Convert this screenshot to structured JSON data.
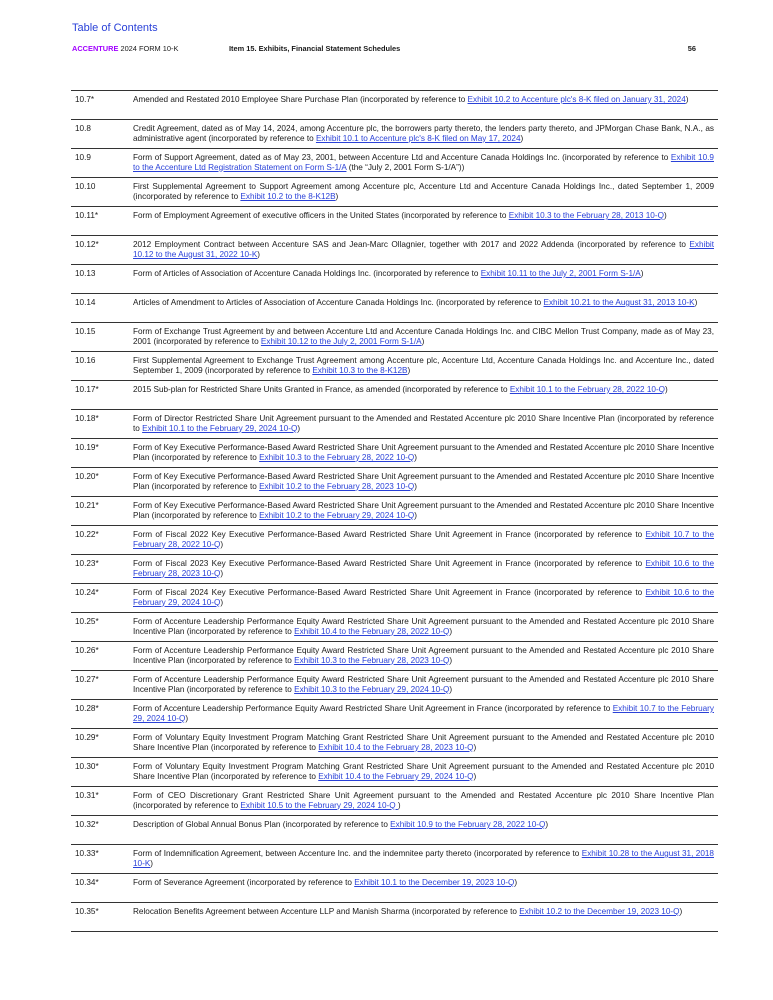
{
  "toc_link": "Table of Contents",
  "header": {
    "brand": "ACCENTURE",
    "form": " 2024 FORM 10-K",
    "section": "Item 15. Exhibits, Financial Statement Schedules",
    "page_number": "56"
  },
  "exhibits": [
    {
      "num": "10.7*",
      "text": "Amended and Restated 2010 Employee Share Purchase Plan (incorporated by reference to ",
      "link": "Exhibit 10.2 to Accenture plc's 8-K filed on January 31, 2024",
      "after": ")"
    },
    {
      "num": "10.8",
      "text": "Credit Agreement, dated as of May 14, 2024, among Accenture plc, the borrowers party thereto, the lenders party thereto, and JPMorgan Chase Bank, N.A., as administrative agent (incorporated by reference to ",
      "link": "Exhibit 10.1 to Accenture plc's 8-K filed on May 17, 2024",
      "after": ")"
    },
    {
      "num": "10.9",
      "text": "Form of Support Agreement, dated as of May 23, 2001, between Accenture Ltd and Accenture Canada Holdings Inc. (incorporated by reference to ",
      "link": "Exhibit 10.9 to the Accenture Ltd Registration Statement on Form S-1/A",
      "after": " (the “July 2, 2001 Form S-1/A”))"
    },
    {
      "num": "10.10",
      "text": "First Supplemental Agreement to Support Agreement among Accenture plc, Accenture Ltd and Accenture Canada Holdings Inc., dated September 1, 2009 (incorporated by reference to ",
      "link": "Exhibit 10.2 to the 8-K12B",
      "after": ")"
    },
    {
      "num": "10.11*",
      "text": "Form of Employment Agreement of executive officers in the United States (incorporated by reference to ",
      "link": "Exhibit 10.3 to the February 28, 2013 10-Q",
      "after": ")"
    },
    {
      "num": "10.12*",
      "text": "2012 Employment Contract between Accenture SAS and Jean-Marc Ollagnier, together with 2017 and 2022 Addenda (incorporated by reference to ",
      "link": "Exhibit 10.12 to the August 31, 2022 10-K",
      "after": ")"
    },
    {
      "num": "10.13",
      "text": "Form of Articles of Association of Accenture Canada Holdings Inc. (incorporated by reference to ",
      "link": "Exhibit 10.11 to the July 2, 2001 Form S-1/A",
      "after": ")"
    },
    {
      "num": "10.14",
      "text": "Articles of Amendment to Articles of Association of Accenture Canada Holdings Inc. (incorporated by reference to ",
      "link": "Exhibit 10.21 to the August 31, 2013 10-K",
      "after": ")"
    },
    {
      "num": "10.15",
      "text": "Form of Exchange Trust Agreement by and between Accenture Ltd and Accenture Canada Holdings Inc. and CIBC Mellon Trust Company, made as of May 23, 2001 (incorporated by reference to ",
      "link": "Exhibit 10.12 to the July 2, 2001 Form S-1/A",
      "after": ")"
    },
    {
      "num": "10.16",
      "text": "First Supplemental Agreement to Exchange Trust Agreement among Accenture plc, Accenture Ltd, Accenture Canada Holdings Inc. and Accenture Inc., dated September 1, 2009 (incorporated by reference to ",
      "link": "Exhibit 10.3 to the 8-K12B",
      "after": ")"
    },
    {
      "num": "10.17*",
      "text": "2015 Sub-plan for Restricted Share Units Granted in France, as amended (incorporated by reference to ",
      "link": "Exhibit 10.1 to the February 28, 2022 10-Q",
      "after": ")"
    },
    {
      "num": "10.18*",
      "text": "Form of Director Restricted Share Unit Agreement pursuant to the Amended and Restated Accenture plc 2010 Share Incentive Plan (incorporated by reference to ",
      "link": "Exhibit 10.1 to the February 29, 2024 10-Q",
      "after": ")"
    },
    {
      "num": "10.19*",
      "text": "Form of Key Executive Performance-Based Award Restricted Share Unit Agreement pursuant to the Amended and Restated Accenture plc 2010 Share Incentive Plan (incorporated by reference to ",
      "link": "Exhibit 10.3 to the February 28, 2022 10-Q",
      "after": ")"
    },
    {
      "num": "10.20*",
      "text": "Form of Key Executive Performance-Based Award Restricted Share Unit Agreement pursuant to the Amended and Restated Accenture plc 2010 Share Incentive Plan (incorporated by reference to ",
      "link": "Exhibit 10.2 to the February 28, 2023 10-Q",
      "after": ")"
    },
    {
      "num": "10.21*",
      "text": "Form of Key Executive Performance-Based Award Restricted Share Unit Agreement pursuant to the Amended and Restated Accenture plc 2010 Share Incentive Plan (incorporated by reference to ",
      "link": "Exhibit 10.2 to the February 29, 2024 10-Q",
      "after": ")"
    },
    {
      "num": "10.22*",
      "text": "Form of Fiscal 2022 Key Executive Performance-Based Award Restricted Share Unit Agreement in France (incorporated by reference to ",
      "link": "Exhibit 10.7 to the February 28, 2022 10-Q",
      "after": ")"
    },
    {
      "num": "10.23*",
      "text": "Form of Fiscal 2023 Key Executive Performance-Based Award Restricted Share Unit Agreement in France (incorporated by reference to ",
      "link": "Exhibit 10.6 to the February 28, 2023 10-Q",
      "after": ")"
    },
    {
      "num": "10.24*",
      "text": "Form of Fiscal 2024 Key Executive Performance-Based Award Restricted Share Unit Agreement in France (incorporated by reference to ",
      "link": "Exhibit 10.6 to the February 29, 2024 10-Q",
      "after": ")"
    },
    {
      "num": "10.25*",
      "text": "Form of Accenture Leadership Performance Equity Award Restricted Share Unit Agreement pursuant to the Amended and Restated Accenture plc 2010 Share Incentive Plan (incorporated by reference to ",
      "link": "Exhibit 10.4 to the February 28, 2022 10-Q",
      "after": ")"
    },
    {
      "num": "10.26*",
      "text": "Form of Accenture Leadership Performance Equity Award Restricted Share Unit Agreement pursuant to the Amended and Restated Accenture plc 2010 Share Incentive Plan (incorporated by reference to ",
      "link": "Exhibit 10.3 to the February 28, 2023 10-Q",
      "after": ")"
    },
    {
      "num": "10.27*",
      "text": "Form of Accenture Leadership Performance Equity Award Restricted Share Unit Agreement pursuant to the Amended and Restated Accenture plc 2010 Share Incentive Plan (incorporated by reference to ",
      "link": "Exhibit 10.3 to the February 29, 2024 10-Q",
      "after": ")"
    },
    {
      "num": "10.28*",
      "text": "Form of Accenture Leadership Performance Equity Award Restricted Share Unit Agreement in France (incorporated by reference to ",
      "link": "Exhibit 10.7 to the February 29, 2024 10-Q",
      "after": ")"
    },
    {
      "num": "10.29*",
      "text": "Form of Voluntary Equity Investment Program Matching Grant Restricted Share Unit Agreement pursuant to the Amended and Restated Accenture plc 2010 Share Incentive Plan (incorporated by reference to ",
      "link": "Exhibit 10.4 to the February 28, 2023 10-Q",
      "after": ")"
    },
    {
      "num": "10.30*",
      "text": "Form of Voluntary Equity Investment Program Matching Grant Restricted Share Unit Agreement pursuant to the Amended and Restated Accenture plc 2010 Share Incentive Plan (incorporated by reference to ",
      "link": "Exhibit 10.4 to the February 29, 2024 10-Q",
      "after": ")"
    },
    {
      "num": "10.31*",
      "text": "Form of CEO Discretionary Grant Restricted Share Unit Agreement pursuant to the Amended and Restated Accenture plc 2010 Share Incentive Plan (incorporated by reference to ",
      "link": "Exhibit 10.5 to the February 29, 2024 10-Q ",
      "after": ")"
    },
    {
      "num": "10.32*",
      "text": "Description of Global Annual Bonus Plan (incorporated by reference to ",
      "link": "Exhibit 10.9 to the February 28, 2022 10-Q",
      "after": ")"
    },
    {
      "num": "10.33*",
      "text": "Form of Indemnification Agreement, between Accenture Inc. and the indemnitee party thereto (incorporated by reference to ",
      "link": "Exhibit 10.28 to the August 31, 2018 10-K",
      "after": ")"
    },
    {
      "num": "10.34*",
      "text": "Form of Severance Agreement (incorporated by reference to ",
      "link": "Exhibit 10.1 to the December 19, 2023 10-Q",
      "after": ")"
    },
    {
      "num": "10.35*",
      "text": "Relocation Benefits Agreement between Accenture LLP and Manish Sharma (incorporated by reference to ",
      "link": "Exhibit 10.2 to the December 19, 2023 10-Q",
      "after": ")"
    }
  ]
}
